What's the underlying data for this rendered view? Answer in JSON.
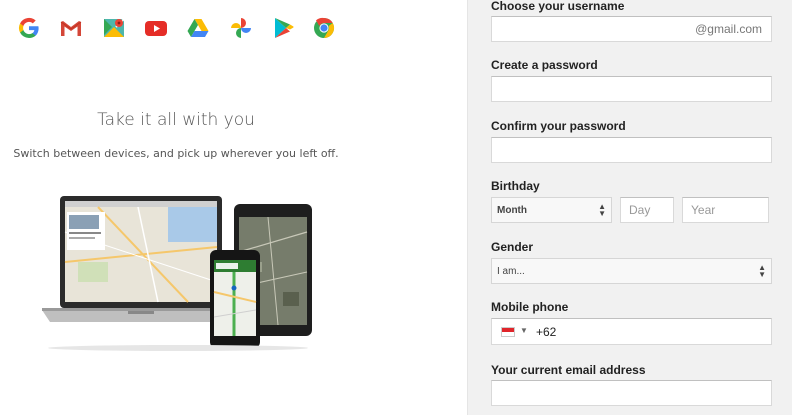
{
  "apps": {
    "icons": [
      "google-g-icon",
      "gmail-icon",
      "maps-icon",
      "youtube-icon",
      "drive-icon",
      "photos-icon",
      "play-store-icon",
      "chrome-icon"
    ],
    "colors": {
      "blue": "#4285f4",
      "red": "#ea4335",
      "yellow": "#fbbc05",
      "green": "#34a853"
    }
  },
  "promo": {
    "title": "Take it all with you",
    "subtitle": "Switch between devices, and pick up wherever you left off."
  },
  "form": {
    "username_label": "Choose your username",
    "username_value": "",
    "username_suffix": "@gmail.com",
    "password_label": "Create a password",
    "password_value": "",
    "confirm_label": "Confirm your password",
    "confirm_value": "",
    "birthday_label": "Birthday",
    "birthday_month": "Month",
    "birthday_day_placeholder": "Day",
    "birthday_year_placeholder": "Year",
    "gender_label": "Gender",
    "gender_value": "I am...",
    "phone_label": "Mobile phone",
    "phone_value": "+62",
    "phone_country_icon": "indonesia-flag-icon",
    "email_label": "Your current email address",
    "email_value": ""
  }
}
